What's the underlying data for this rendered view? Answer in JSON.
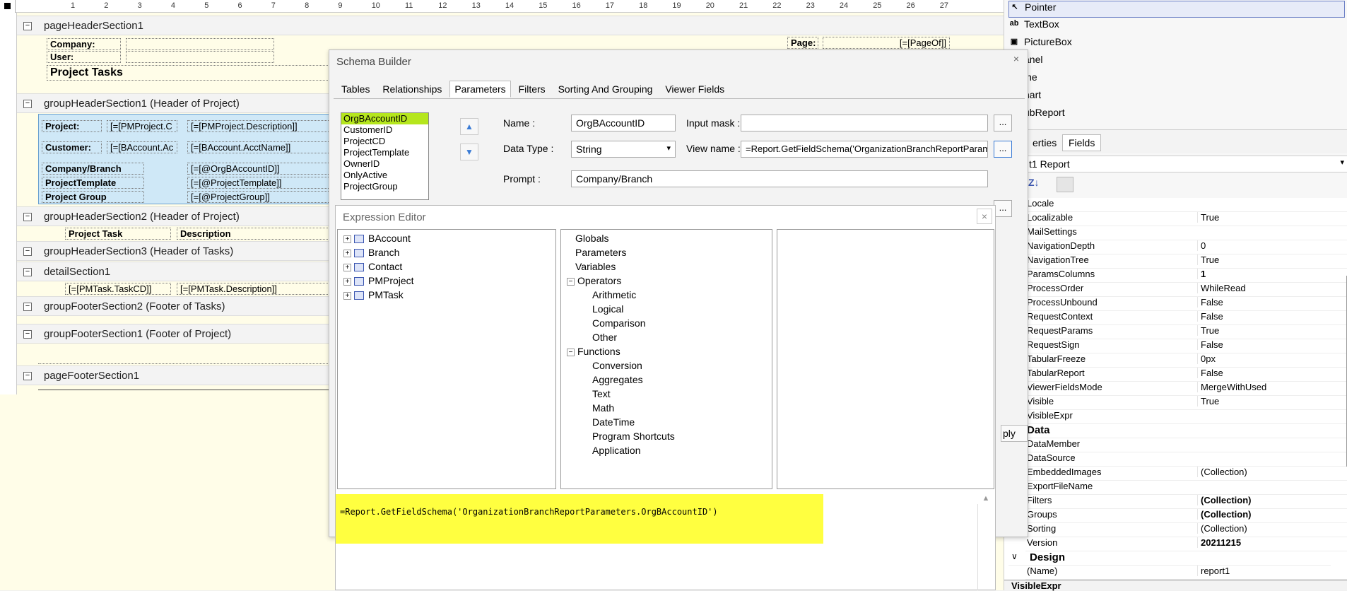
{
  "ruler": {
    "numbers": [
      "1",
      "2",
      "3",
      "4",
      "5",
      "6",
      "7",
      "8",
      "9",
      "10",
      "11",
      "12",
      "13",
      "14",
      "15",
      "16",
      "17",
      "18",
      "19",
      "20",
      "21",
      "22",
      "23",
      "24",
      "25",
      "26",
      "27"
    ]
  },
  "bands": {
    "page_header": "pageHeaderSection1",
    "group_header1": "groupHeaderSection1 (Header of Project)",
    "group_header2": "groupHeaderSection2 (Header of Project)",
    "group_header3": "groupHeaderSection3 (Header of Tasks)",
    "detail": "detailSection1",
    "group_footer2": "groupFooterSection2 (Footer of Tasks)",
    "group_footer1": "groupFooterSection1 (Footer of Project)",
    "page_footer": "pageFooterSection1"
  },
  "fields": {
    "company": "Company:",
    "user": "User:",
    "project_tasks": "Project Tasks",
    "page": "Page:",
    "page_of": "[=[PageOf]]",
    "project": "Project:",
    "project_c": "[=[PMProject.C",
    "project_desc": "[=[PMProject.Description]]",
    "customer": "Customer:",
    "baccount_ac": "[=[BAccount.Ac",
    "baccount_name": "[=[BAccount.AcctName]]",
    "company_branch": "Company/Branch",
    "org_baccount": "[=[@OrgBAccountID]]",
    "project_template": "ProjectTemplate",
    "project_template_val": "[=[@ProjectTemplate]]",
    "project_group": "Project Group",
    "project_group_val": "[=[@ProjectGroup]]",
    "project_task": "Project Task",
    "description": "Description",
    "task_cd": "[=[PMTask.TaskCD]]",
    "task_desc": "[=[PMTask.Description]]"
  },
  "schema": {
    "title": "Schema Builder",
    "close": "×",
    "tabs": [
      "Tables",
      "Relationships",
      "Parameters",
      "Filters",
      "Sorting And Grouping",
      "Viewer Fields"
    ],
    "active_tab": "Parameters",
    "params": [
      "OrgBAccountID",
      "CustomerID",
      "ProjectCD",
      "ProjectTemplate",
      "OwnerID",
      "OnlyActive",
      "ProjectGroup"
    ],
    "name_label": "Name :",
    "name_value": "OrgBAccountID",
    "input_mask_label": "Input mask :",
    "input_mask_value": "",
    "data_type_label": "Data Type :",
    "data_type_value": "String",
    "view_name_label": "View name :",
    "view_name_value": "=Report.GetFieldSchema('OrganizationBranchReportParam",
    "prompt_label": "Prompt :",
    "prompt_value": "Company/Branch",
    "dots": "...",
    "apply": "ply"
  },
  "expression": {
    "title": "Expression Editor",
    "close": "×",
    "tables": [
      "BAccount",
      "Branch",
      "Contact",
      "PMProject",
      "PMTask"
    ],
    "globals": "Globals",
    "parameters": "Parameters",
    "variables": "Variables",
    "operators": "Operators",
    "operator_items": [
      "Arithmetic",
      "Logical",
      "Comparison",
      "Other"
    ],
    "functions": "Functions",
    "function_items": [
      "Conversion",
      "Aggregates",
      "Text",
      "Math",
      "DateTime",
      "Program Shortcuts",
      "Application"
    ],
    "text": "=Report.GetFieldSchema('OrganizationBranchReportParameters.OrgBAccountID')"
  },
  "toolbox": [
    "Pointer",
    "TextBox",
    "PictureBox",
    "anel",
    "ine",
    "hart",
    "ubReport"
  ],
  "props": {
    "tab1": "erties",
    "tab2": "Fields",
    "object": "t1 Report",
    "rows": [
      {
        "k": "Locale",
        "v": ""
      },
      {
        "k": "Localizable",
        "v": "True"
      },
      {
        "k": "MailSettings",
        "v": ""
      },
      {
        "k": "NavigationDepth",
        "v": "0"
      },
      {
        "k": "NavigationTree",
        "v": "True"
      },
      {
        "k": "ParamsColumns",
        "v": "1",
        "b": true
      },
      {
        "k": "ProcessOrder",
        "v": "WhileRead"
      },
      {
        "k": "ProcessUnbound",
        "v": "False"
      },
      {
        "k": "RequestContext",
        "v": "False"
      },
      {
        "k": "RequestParams",
        "v": "True"
      },
      {
        "k": "RequestSign",
        "v": "False"
      },
      {
        "k": "TabularFreeze",
        "v": "0px"
      },
      {
        "k": "TabularReport",
        "v": "False"
      },
      {
        "k": "ViewerFieldsMode",
        "v": "MergeWithUsed"
      },
      {
        "k": "Visible",
        "v": "True"
      },
      {
        "k": "VisibleExpr",
        "v": ""
      },
      {
        "k": "Data",
        "v": "",
        "cat": true
      },
      {
        "k": "DataMember",
        "v": ""
      },
      {
        "k": "DataSource",
        "v": ""
      },
      {
        "k": "EmbeddedImages",
        "v": "(Collection)"
      },
      {
        "k": "ExportFileName",
        "v": ""
      },
      {
        "k": "Filters",
        "v": "(Collection)",
        "b": true
      },
      {
        "k": "Groups",
        "v": "(Collection)",
        "b": true
      },
      {
        "k": "Sorting",
        "v": "(Collection)"
      },
      {
        "k": "Version",
        "v": "20211215",
        "b": true
      },
      {
        "k": "Design",
        "v": "",
        "cat": true
      },
      {
        "k": "(Name)",
        "v": "report1"
      }
    ],
    "footer": "VisibleExpr"
  }
}
